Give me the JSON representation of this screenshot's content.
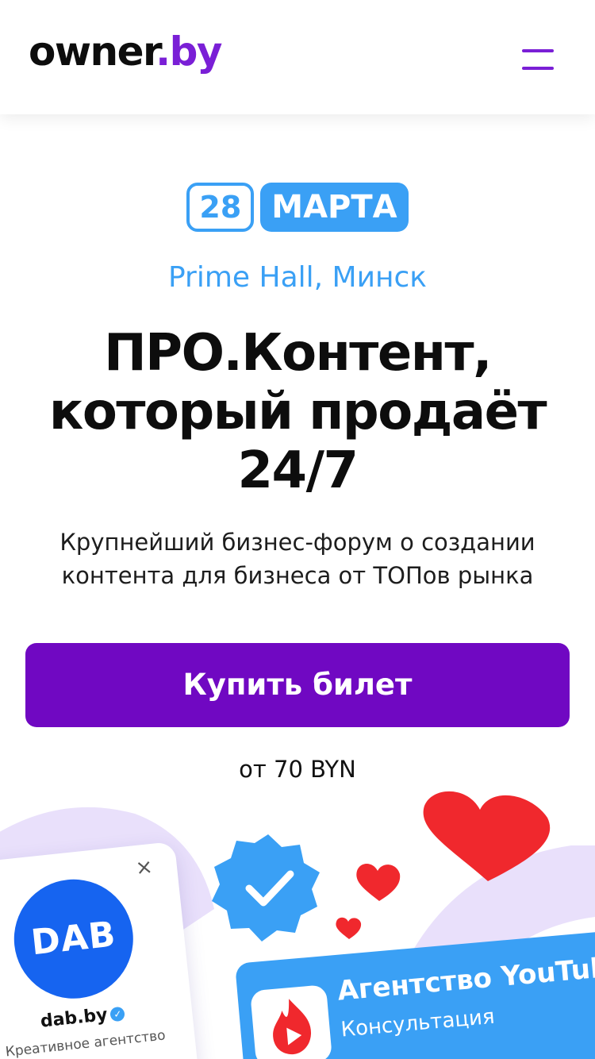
{
  "header": {
    "logo_main": "owner",
    "logo_domain": ".by"
  },
  "event": {
    "day": "28",
    "month": "МАРТА",
    "venue": "Prime Hall, Минск",
    "title_line1": "ПРО.Контент,",
    "title_line2": "который продаёт",
    "title_line3": "24/7",
    "subtitle_line1": "Крупнейший бизнес-форум о создании",
    "subtitle_line2": "контента для бизнеса от ТОПов рынка"
  },
  "cta": {
    "buy_label": "Купить билет",
    "price_label": "от 70 BYN"
  },
  "illustration": {
    "dab_card": {
      "logo_text": "DAB",
      "name": "dab.by",
      "description": "Креативное агентство",
      "close_symbol": "×",
      "verified_symbol": "✓"
    },
    "agency_card": {
      "title": "Агентство YouTube",
      "subtitle": "Консультация"
    }
  },
  "colors": {
    "brand_purple": "#7008c2",
    "accent_blue": "#3aa0f5",
    "heart_red": "#f0282d",
    "lavender": "#e9e0fb"
  }
}
